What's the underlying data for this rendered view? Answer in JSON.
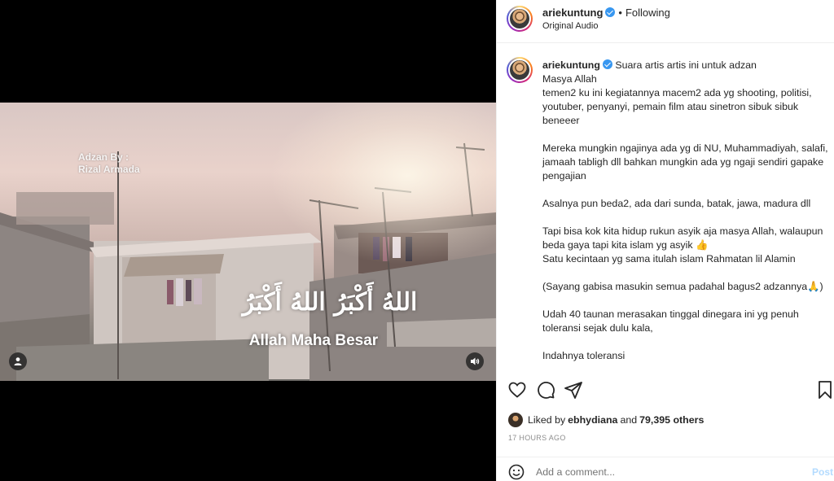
{
  "video": {
    "credit_line1": "Adzan By :",
    "credit_line2": "Rizal Armada",
    "arabic_text": "اللهُ أَكْبَرُ اللهُ أَكْبَرُ",
    "caption": "Allah Maha Besar",
    "user_icon": "user-icon",
    "sound_icon": "speaker-icon"
  },
  "header": {
    "username": "ariekuntung",
    "separator": "•",
    "follow_status": "Following",
    "audio": "Original Audio"
  },
  "post": {
    "username": "ariekuntung",
    "caption_first": "Suara artis artis ini untuk adzan",
    "caption_body": "Masya Allah\ntemen2 ku ini kegiatannya macem2 ada yg shooting, politisi, youtuber, penyanyi, pemain film atau sinetron sibuk sibuk beneeer\n\nMereka mungkin ngajinya ada yg di NU, Muhammadiyah, salafi, jamaah tabligh dll bahkan mungkin ada yg ngaji sendiri gapake pengajian\n\nAsalnya pun beda2, ada dari sunda, batak, jawa, madura dll\n\nTapi bisa kok kita hidup rukun asyik aja masya Allah, walaupun beda gaya tapi kita islam yg asyik 👍\nSatu kecintaan yg sama itulah islam Rahmatan lil Alamin\n\n(Sayang gabisa masukin semua padahal bagus2 adzannya🙏)\n\nUdah 40 taunan merasakan tinggal dinegara ini yg penuh toleransi sejak dulu kala,\n\nIndahnya toleransi\n\nSeorang muslim yg tinggal dibali pun menghormati nyepi, begitu juga sebaliknya\nYg dimanado juga santai kalau ke mall banyak pohon natal"
  },
  "likes": {
    "prefix": "Liked by",
    "user": "ebhydiana",
    "middle": "and",
    "count": "79,395 others"
  },
  "timestamp": "17 HOURS AGO",
  "comment_box": {
    "placeholder": "Add a comment...",
    "post_label": "Post"
  },
  "colors": {
    "verified": "#3897f0",
    "post_disabled": "#b3dbff",
    "muted": "#8e8e8e"
  }
}
